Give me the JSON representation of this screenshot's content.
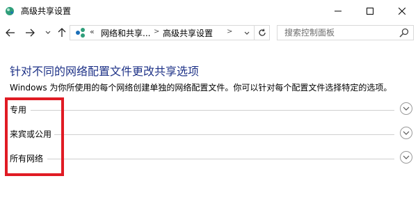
{
  "window": {
    "title": "高级共享设置",
    "minimize_icon": "minimize-icon",
    "maximize_icon": "maximize-icon",
    "close_icon": "close-icon"
  },
  "navigation": {
    "back_icon": "back-arrow-icon",
    "forward_icon": "forward-arrow-icon",
    "recent_icon": "recent-locations-chevron-icon",
    "up_icon": "up-arrow-icon"
  },
  "address": {
    "overflow": "«",
    "breadcrumbs": [
      "网络和共享...",
      "高级共享设置"
    ],
    "separator": ">",
    "refresh_icon": "refresh-icon"
  },
  "search": {
    "placeholder": "搜索控制面板",
    "icon": "search-icon"
  },
  "main": {
    "heading": "针对不同的网络配置文件更改共享选项",
    "description": "Windows 为你所使用的每个网络创建单独的网络配置文件。你可以针对每个配置文件选择特定的选项。",
    "sections": [
      {
        "label": "专用"
      },
      {
        "label": "来宾或公用"
      },
      {
        "label": "所有网络"
      }
    ]
  },
  "colors": {
    "heading": "#1e3287",
    "highlight_border": "#e01b24",
    "section_line": "#cfcfcf"
  }
}
